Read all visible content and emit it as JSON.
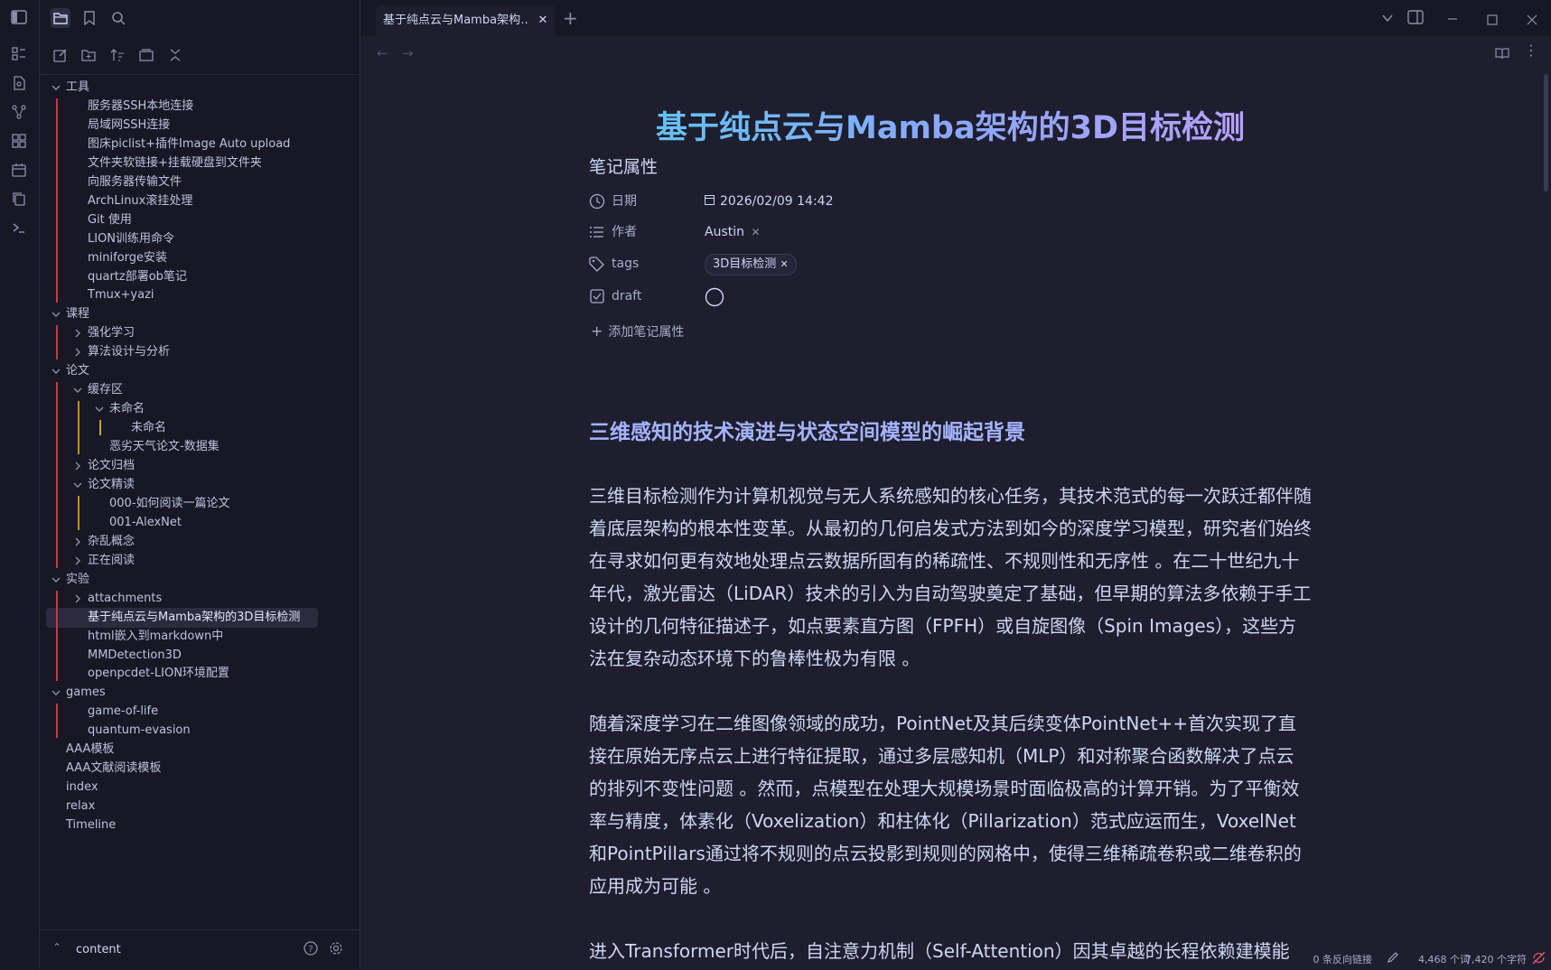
{
  "ribbon": {
    "icons": [
      "sidebar-toggle-icon",
      "dashboard-icon",
      "file-icon",
      "graph-icon",
      "grid-icon",
      "calendar-icon",
      "copy-icon",
      "terminal-icon"
    ]
  },
  "sidebar": {
    "top_icons": [
      "folder-icon",
      "bookmark-icon",
      "search-icon"
    ],
    "tool_icons": [
      "new-note-icon",
      "new-folder-icon",
      "sort-icon",
      "collapse-icon",
      "expand-icon"
    ],
    "tree": [
      {
        "label": "工具"
      },
      {
        "label": "服务器SSH本地连接"
      },
      {
        "label": "局域网SSH连接"
      },
      {
        "label": "图床piclist+插件Image Auto upload"
      },
      {
        "label": "文件夹软链接+挂载硬盘到文件夹"
      },
      {
        "label": "向服务器传输文件"
      },
      {
        "label": "ArchLinux滚挂处理"
      },
      {
        "label": "Git 使用"
      },
      {
        "label": "LION训练用命令"
      },
      {
        "label": "miniforge安装"
      },
      {
        "label": "quartz部署ob笔记"
      },
      {
        "label": "Tmux+yazi"
      },
      {
        "label": "课程"
      },
      {
        "label": "强化学习"
      },
      {
        "label": "算法设计与分析"
      },
      {
        "label": "论文"
      },
      {
        "label": "缓存区"
      },
      {
        "label": "未命名"
      },
      {
        "label": "未命名"
      },
      {
        "label": "恶劣天气论文-数据集"
      },
      {
        "label": "论文归档"
      },
      {
        "label": "论文精读"
      },
      {
        "label": "000-如何阅读一篇论文"
      },
      {
        "label": "001-AlexNet"
      },
      {
        "label": "杂乱概念"
      },
      {
        "label": "正在阅读"
      },
      {
        "label": "实验"
      },
      {
        "label": "attachments"
      },
      {
        "label": "基于纯点云与Mamba架构的3D目标检测"
      },
      {
        "label": "html嵌入到markdown中"
      },
      {
        "label": "MMDetection3D"
      },
      {
        "label": "openpcdet-LION环境配置"
      },
      {
        "label": "games"
      },
      {
        "label": "game-of-life"
      },
      {
        "label": "quantum-evasion"
      },
      {
        "label": "AAA模板"
      },
      {
        "label": "AAA文献阅读模板"
      },
      {
        "label": "index"
      },
      {
        "label": "relax"
      },
      {
        "label": "Timeline"
      }
    ],
    "vault_name": "content"
  },
  "tab": {
    "title": "基于纯点云与Mamba架构…"
  },
  "note": {
    "title": "基于纯点云与Mamba架构的3D目标检测",
    "properties_heading": "笔记属性",
    "properties": {
      "date_key": "日期",
      "date_value": "2026/02/09 14:42",
      "author_key": "作者",
      "author_value": "Austin",
      "tags_key": "tags",
      "tag_value": "3D目标检测",
      "draft_key": "draft"
    },
    "add_property": "添加笔记属性",
    "heading": "三维感知的技术演进与状态空间模型的崛起背景",
    "paragraphs": [
      "三维目标检测作为计算机视觉与无人系统感知的核心任务，其技术范式的每一次跃迁都伴随着底层架构的根本性变革。从最初的几何启发式方法到如今的深度学习模型，研究者们始终在寻求如何更有效地处理点云数据所固有的稀疏性、不规则性和无序性 。在二十世纪九十年代，激光雷达（LiDAR）技术的引入为自动驾驶奠定了基础，但早期的算法多依赖于手工设计的几何特征描述子，如点要素直方图（FPFH）或自旋图像（Spin Images），这些方法在复杂动态环境下的鲁棒性极为有限 。",
      "随着深度学习在二维图像领域的成功，PointNet及其后续变体PointNet++首次实现了直接在原始无序点云上进行特征提取，通过多层感知机（MLP）和对称聚合函数解决了点云的排列不变性问题 。然而，点模型在处理大规模场景时面临极高的计算开销。为了平衡效率与精度，体素化（Voxelization）和柱体化（Pillarization）范式应运而生，VoxelNet和PointPillars通过将不规则的点云投影到规则的网格中，使得三维稀疏卷积或二维卷积的应用成为可能 。",
      "进入Transformer时代后，自注意力机制（Self-Attention）因其卓越的长程依赖建模能"
    ]
  },
  "status": {
    "backlinks": "0 条反向链接",
    "words": "4,468 个词",
    "chars": "7,420 个字符"
  }
}
